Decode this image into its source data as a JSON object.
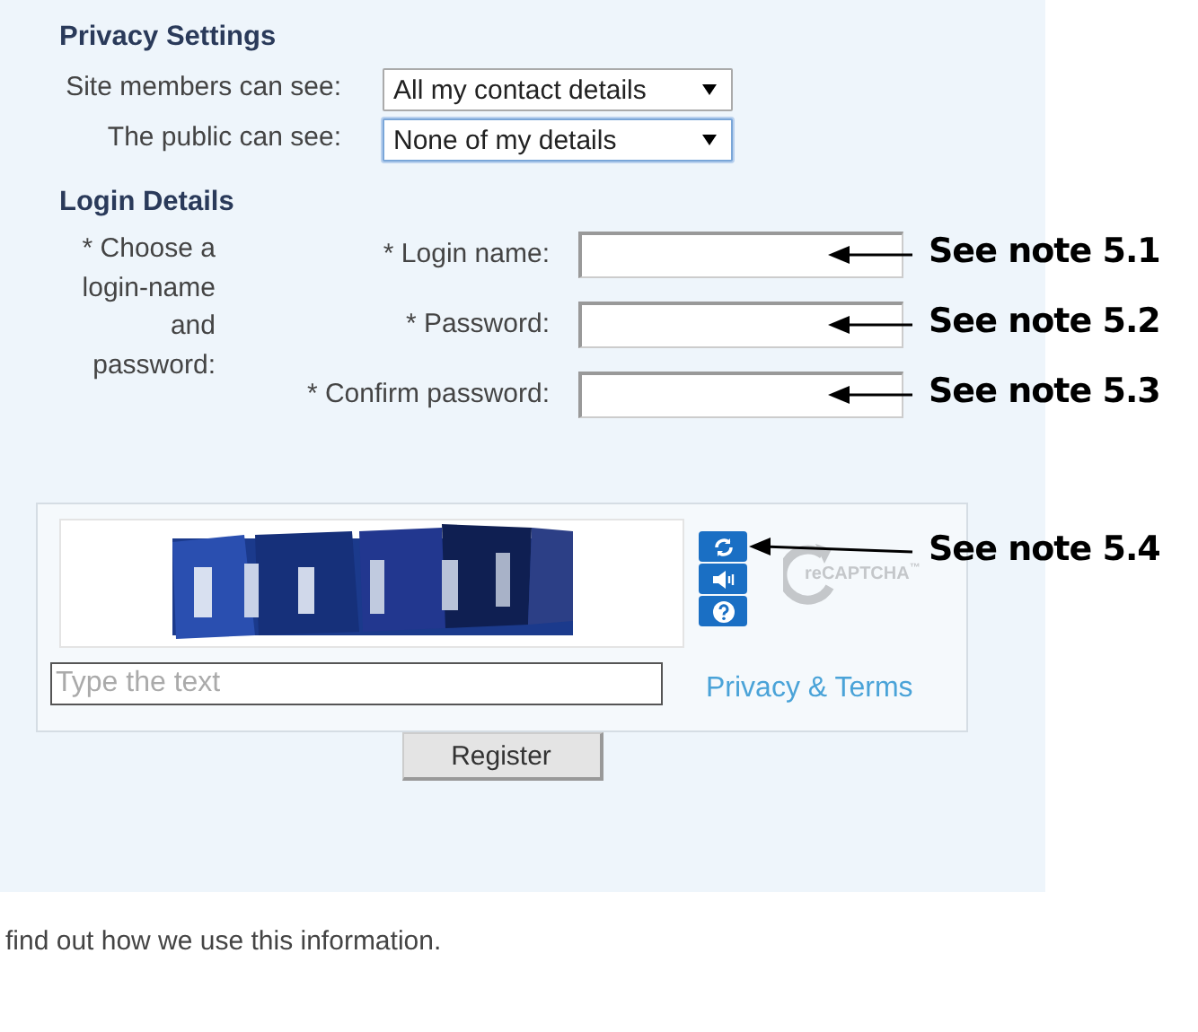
{
  "privacy": {
    "heading": "Privacy Settings",
    "rows": [
      {
        "label": "Site members can see:",
        "value": "All my contact details",
        "focused": false
      },
      {
        "label": "The public can see:",
        "value": "None of my details",
        "focused": true
      }
    ]
  },
  "login": {
    "heading": "Login Details",
    "intro": "* Choose a login-name and password:",
    "fields": [
      {
        "label": "* Login name:"
      },
      {
        "label": "* Password:"
      },
      {
        "label": "* Confirm password:"
      }
    ]
  },
  "captcha": {
    "placeholder": "Type the text",
    "logo": "reCAPTCHA",
    "trademark": "™",
    "link": "Privacy & Terms"
  },
  "register": "Register",
  "footer": "find out how we use this information.",
  "notes": [
    {
      "text": "See note 5.1",
      "kind": "field"
    },
    {
      "text": "See note 5.2",
      "kind": "field"
    },
    {
      "text": "See note 5.3",
      "kind": "field"
    },
    {
      "text": "See note 5.4",
      "kind": "button"
    }
  ]
}
